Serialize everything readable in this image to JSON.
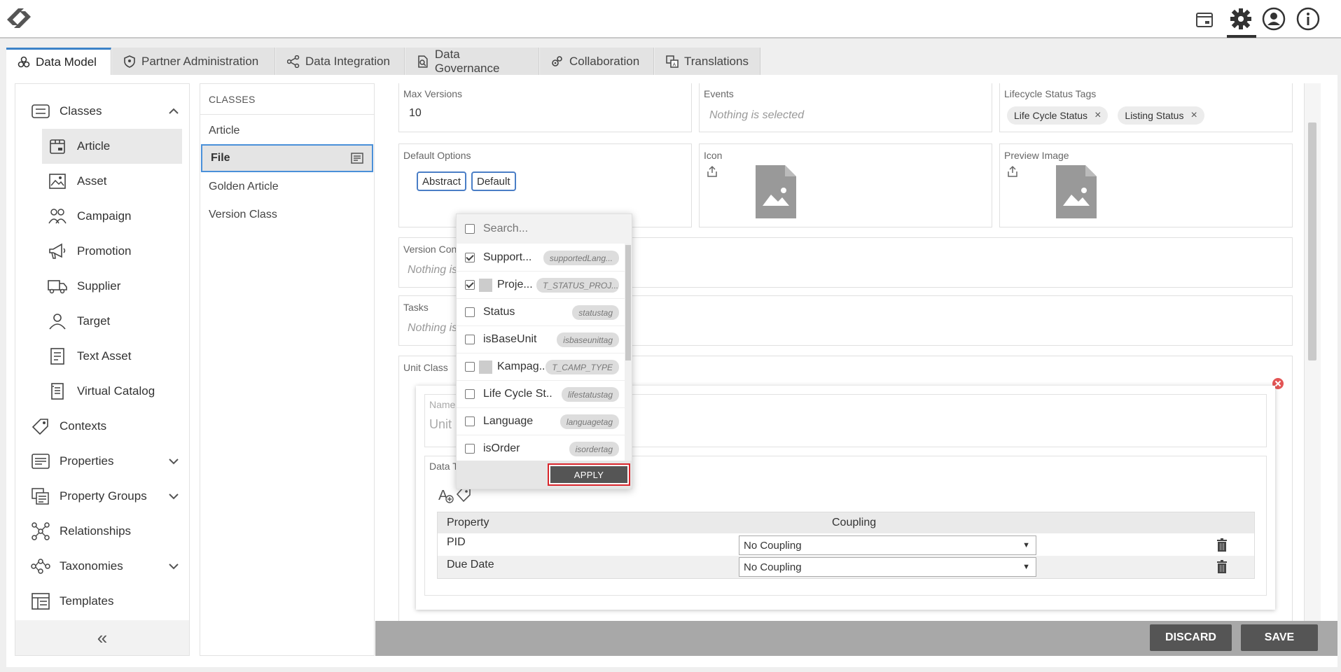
{
  "header": {
    "icons": [
      "logo-icon",
      "package-icon",
      "gear-icon",
      "user-icon",
      "info-icon"
    ]
  },
  "tabs": [
    {
      "label": "Data Model",
      "icon": "cubes-icon",
      "active": true
    },
    {
      "label": "Partner Administration",
      "icon": "shield-icon",
      "active": false
    },
    {
      "label": "Data Integration",
      "icon": "network-icon",
      "active": false
    },
    {
      "label": "Data Governance",
      "icon": "search-doc-icon",
      "active": false
    },
    {
      "label": "Collaboration",
      "icon": "gears-icon",
      "active": false
    },
    {
      "label": "Translations",
      "icon": "translate-icon",
      "active": false
    }
  ],
  "sidebar": {
    "items": [
      {
        "label": "Classes",
        "icon": "list-icon",
        "expanded": true
      },
      {
        "label": "Article",
        "icon": "box-icon"
      },
      {
        "label": "Asset",
        "icon": "image-icon"
      },
      {
        "label": "Campaign",
        "icon": "people-icon"
      },
      {
        "label": "Promotion",
        "icon": "megaphone-icon"
      },
      {
        "label": "Supplier",
        "icon": "truck-icon"
      },
      {
        "label": "Target",
        "icon": "person-icon"
      },
      {
        "label": "Text Asset",
        "icon": "text-doc-icon"
      },
      {
        "label": "Virtual Catalog",
        "icon": "catalog-icon"
      },
      {
        "label": "Contexts",
        "icon": "tag-icon"
      },
      {
        "label": "Properties",
        "icon": "properties-icon"
      },
      {
        "label": "Property Groups",
        "icon": "property-groups-icon"
      },
      {
        "label": "Relationships",
        "icon": "relationships-icon"
      },
      {
        "label": "Taxonomies",
        "icon": "taxonomy-icon"
      },
      {
        "label": "Templates",
        "icon": "templates-icon"
      }
    ],
    "collapse_glyph": "«"
  },
  "classes": {
    "heading": "CLASSES",
    "items": [
      "Article",
      "File",
      "Golden Article",
      "Version Class"
    ]
  },
  "form": {
    "max_versions": {
      "label": "Max Versions",
      "value": "10"
    },
    "events": {
      "label": "Events",
      "placeholder": "Nothing is selected"
    },
    "lifecycle": {
      "label": "Lifecycle Status Tags",
      "chips": [
        "Life Cycle Status",
        "Listing Status"
      ],
      "remove_glyph": "×"
    },
    "default_options": {
      "label": "Default Options",
      "buttons": [
        "Abstract",
        "Default"
      ]
    },
    "icon": {
      "label": "Icon"
    },
    "preview_image": {
      "label": "Preview Image"
    },
    "version_control": {
      "label": "Version Con",
      "placeholder": "Nothing is"
    },
    "tasks": {
      "label": "Tasks",
      "placeholder": "Nothing is"
    },
    "unit_class": {
      "label": "Unit Class",
      "name_label": "Name",
      "name_value": "Unit",
      "data_types_label": "Data T",
      "table": {
        "headers": [
          "Property",
          "Coupling"
        ],
        "rows": [
          {
            "property": "PID",
            "coupling": "No Coupling"
          },
          {
            "property": "Due Date",
            "coupling": "No Coupling"
          }
        ]
      }
    }
  },
  "dropdown": {
    "search_placeholder": "Search...",
    "items": [
      {
        "name": "Support...",
        "tag": "supportedLang...",
        "checked": true,
        "swatch": false
      },
      {
        "name": "Proje...",
        "tag": "T_STATUS_PROJ...",
        "checked": true,
        "swatch": true
      },
      {
        "name": "Status",
        "tag": "statustag",
        "checked": false,
        "swatch": false
      },
      {
        "name": "isBaseUnit",
        "tag": "isbaseunittag",
        "checked": false,
        "swatch": false
      },
      {
        "name": "Kampag...",
        "tag": "T_CAMP_TYPE",
        "checked": false,
        "swatch": true
      },
      {
        "name": "Life Cycle St...",
        "tag": "lifestatustag",
        "checked": false,
        "swatch": false
      },
      {
        "name": "Language",
        "tag": "languagetag",
        "checked": false,
        "swatch": false
      },
      {
        "name": "isOrder",
        "tag": "isordertag",
        "checked": false,
        "swatch": false
      }
    ],
    "apply_label": "APPLY"
  },
  "footer": {
    "discard_label": "DISCARD",
    "save_label": "SAVE"
  },
  "colors": {
    "accent": "#4a90d9",
    "apply_outline": "#d9262c",
    "footer": "#a8a8a8",
    "button_dark": "#555555"
  }
}
